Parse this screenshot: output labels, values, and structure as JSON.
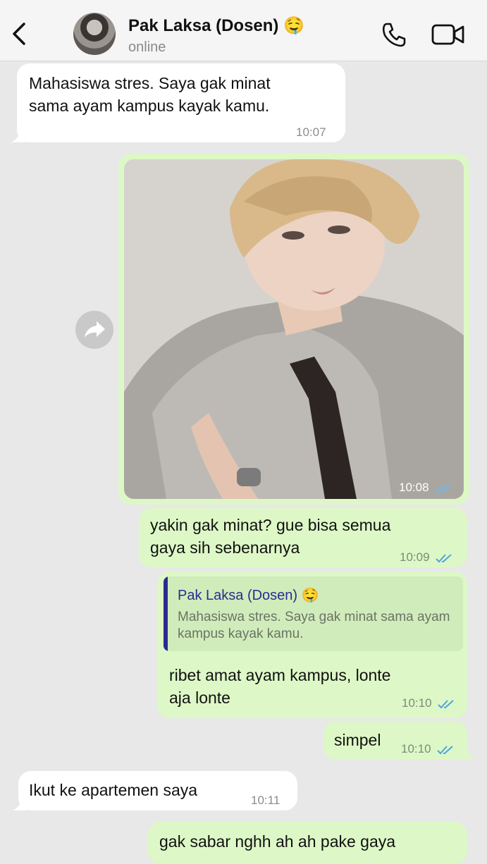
{
  "header": {
    "contact_name": "Pak Laksa (Dosen) 🤤",
    "status": "online"
  },
  "messages": [
    {
      "text": "Mahasiswa stres. Saya gak minat sama ayam kampus kayak kamu.",
      "line1": "Mahasiswa stres. Saya gak minat",
      "line2": "sama ayam kampus kayak kamu.",
      "time": "10:07",
      "direction": "incoming"
    },
    {
      "type": "photo",
      "time": "10:08",
      "direction": "outgoing",
      "status": "read"
    },
    {
      "text": "yakin gak minat? gue bisa semua gaya sih sebenarnya",
      "line1": "yakin gak minat? gue bisa semua",
      "line2": "gaya sih sebenarnya",
      "time": "10:09",
      "direction": "outgoing",
      "status": "read"
    },
    {
      "reply_to": {
        "name": "Pak Laksa (Dosen) 🤤",
        "text": "Mahasiswa stres. Saya gak minat sama ayam kampus kayak kamu."
      },
      "text": "ribet amat ayam kampus, lonte aja lonte",
      "line1": "ribet amat ayam kampus, lonte",
      "line2": "aja lonte",
      "time": "10:10",
      "direction": "outgoing",
      "status": "read"
    },
    {
      "text": "simpel",
      "time": "10:10",
      "direction": "outgoing",
      "status": "read"
    },
    {
      "text": "Ikut ke apartemen saya",
      "time": "10:11",
      "direction": "incoming"
    },
    {
      "text": "gak sabar nghh ah ah pake gaya",
      "time": "",
      "direction": "outgoing"
    }
  ],
  "colors": {
    "chat_background": "#e8e8e8",
    "incoming_bubble": "#ffffff",
    "outgoing_bubble": "#ddf8c6",
    "read_ticks": "#4fa3e0",
    "reply_accent": "#2b2b8f"
  },
  "icons": [
    "back-chevron-icon",
    "phone-icon",
    "video-camera-icon",
    "forward-arrow-icon",
    "double-check-icon"
  ]
}
